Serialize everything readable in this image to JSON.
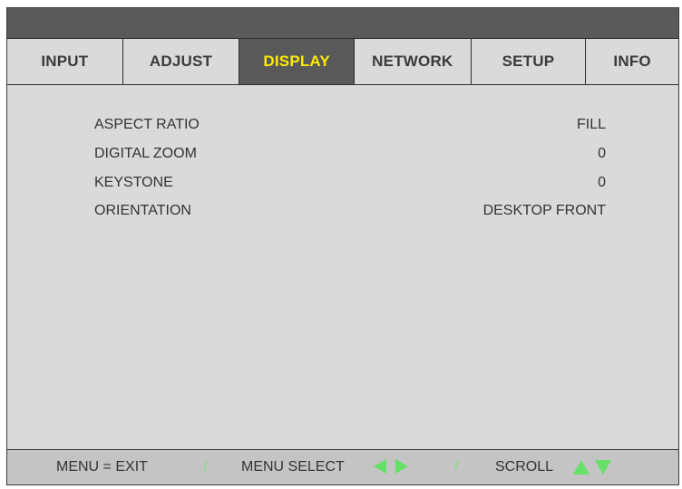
{
  "tabs": [
    {
      "label": "INPUT"
    },
    {
      "label": "ADJUST"
    },
    {
      "label": "DISPLAY",
      "active": true
    },
    {
      "label": "NETWORK"
    },
    {
      "label": "SETUP"
    },
    {
      "label": "INFO"
    }
  ],
  "menu": {
    "items": [
      {
        "label": "ASPECT RATIO",
        "value": "FILL"
      },
      {
        "label": "DIGITAL ZOOM",
        "value": "0"
      },
      {
        "label": "KEYSTONE",
        "value": "0"
      },
      {
        "label": "ORIENTATION",
        "value": "DESKTOP FRONT"
      }
    ]
  },
  "footer": {
    "exit_hint": "MENU = EXIT",
    "separator": "/",
    "select_hint": "MENU SELECT",
    "scroll_hint": "SCROLL",
    "select_icons": [
      "left-arrow-icon",
      "right-arrow-icon"
    ],
    "scroll_icons": [
      "up-arrow-icon",
      "down-arrow-icon"
    ]
  },
  "colors": {
    "active_tab_bg": "#595959",
    "active_tab_text": "#ffea00",
    "panel_bg": "#dadada",
    "arrow_green": "#66e066"
  }
}
